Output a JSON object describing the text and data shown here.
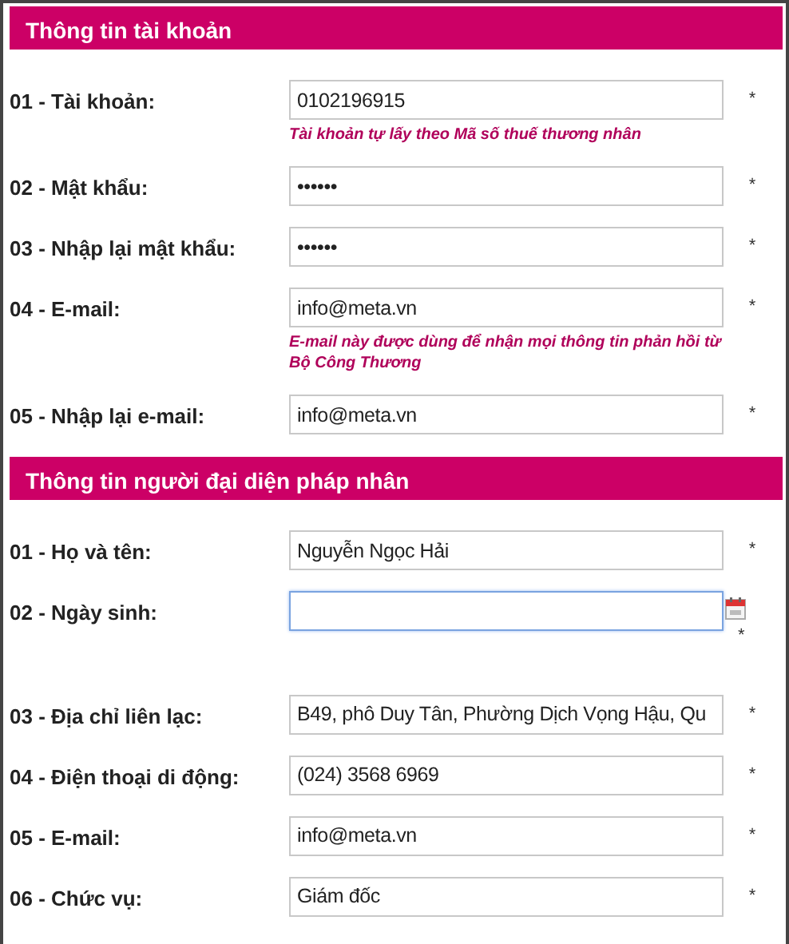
{
  "sections": [
    {
      "title": "Thông tin tài khoản",
      "fields": [
        {
          "kind": "text",
          "label": "01 - Tài khoản:",
          "value": "0102196915",
          "required_mark": "*",
          "hint": "Tài khoản tự lấy theo Mã số thuế thương nhân",
          "focused": false
        },
        {
          "kind": "text",
          "label": "02 - Mật khẩu:",
          "value": "••••••",
          "required_mark": "*",
          "focused": false
        },
        {
          "kind": "text",
          "label": "03 - Nhập lại mật khẩu:",
          "value": "••••••",
          "required_mark": "*",
          "focused": false
        },
        {
          "kind": "text",
          "label": "04 - E-mail:",
          "value": "info@meta.vn",
          "required_mark": "*",
          "hint": "E-mail này được dùng để nhận mọi thông tin phản hồi từ Bộ Công Thương",
          "focused": false
        },
        {
          "kind": "text",
          "label": "05 - Nhập lại e-mail:",
          "value": "info@meta.vn",
          "required_mark": "*",
          "focused": false
        }
      ]
    },
    {
      "title": "Thông tin người đại diện pháp nhân",
      "fields": [
        {
          "kind": "text",
          "label": "01 - Họ và tên:",
          "value": "Nguyễn Ngọc Hải",
          "required_mark": "*",
          "focused": false
        },
        {
          "kind": "date",
          "label": "02 - Ngày sinh:",
          "required_mark": "*",
          "focused": true
        },
        {
          "kind": "text",
          "label": "03 - Địa chỉ liên lạc:",
          "value": "B49, phô Duy Tân, Phường Dịch Vọng Hậu, Qu",
          "required_mark": "*",
          "focused": false
        },
        {
          "kind": "text",
          "label": "04 - Điện thoại di động:",
          "value": "(024) 3568 6969",
          "required_mark": "*",
          "focused": false
        },
        {
          "kind": "text",
          "label": "05 - E-mail:",
          "value": "info@meta.vn",
          "required_mark": "*",
          "focused": false
        },
        {
          "kind": "text",
          "label": "06 - Chức vụ:",
          "value": "Giám đốc",
          "required_mark": "*",
          "focused": false
        }
      ]
    }
  ]
}
